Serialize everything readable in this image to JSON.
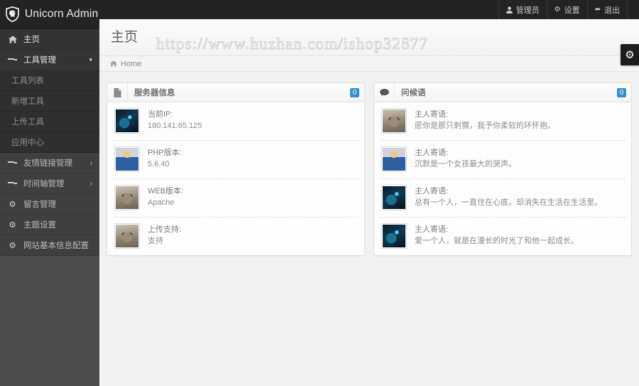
{
  "brand": {
    "name": "Unicorn Admin",
    "logo_icon": "shield-unicorn-icon"
  },
  "topbar": {
    "links": [
      {
        "label": "管理员",
        "icon": "user-icon"
      },
      {
        "label": "设置",
        "icon": "gear-icon"
      },
      {
        "label": "退出",
        "icon": "signout-icon"
      }
    ],
    "gear_tab_icon": "gear-icon"
  },
  "page": {
    "title": "主页",
    "watermark": "https://www.huzhan.com/ishop32877",
    "breadcrumb": {
      "icon": "home-icon",
      "label": "Home"
    }
  },
  "sidebar": {
    "items": [
      {
        "label": "主页",
        "icon": "home-icon",
        "state": "active",
        "caret": ""
      },
      {
        "label": "工具管理",
        "icon": "list-icon",
        "state": "open",
        "caret": "▾"
      },
      {
        "label": "友情链接管理",
        "icon": "list-icon",
        "state": "",
        "caret": "›"
      },
      {
        "label": "时间轴管理",
        "icon": "list-icon",
        "state": "",
        "caret": "›"
      },
      {
        "label": "留言管理",
        "icon": "gear-icon",
        "state": "",
        "caret": ""
      },
      {
        "label": "主题设置",
        "icon": "gear-icon",
        "state": "",
        "caret": ""
      },
      {
        "label": "网站基本信息配置",
        "icon": "gear-icon",
        "state": "",
        "caret": ""
      }
    ],
    "submenu": [
      {
        "label": "工具列表"
      },
      {
        "label": "新增工具"
      },
      {
        "label": "上传工具"
      },
      {
        "label": "应用中心"
      }
    ]
  },
  "panels": {
    "server": {
      "title": "服务器信息",
      "icon": "file-icon",
      "badge": "0",
      "rows": [
        {
          "label": "当前IP:",
          "value": "180.141.65.125",
          "avatar": "av-blue"
        },
        {
          "label": "PHP版本:",
          "value": "5.6.40",
          "avatar": "av-cop"
        },
        {
          "label": "WEB版本:",
          "value": "Apache",
          "avatar": "av-raccoon"
        },
        {
          "label": "上传支持:",
          "value": "支持",
          "avatar": "av-raccoon"
        }
      ]
    },
    "greeting": {
      "title": "问候语",
      "icon": "comment-icon",
      "badge": "0",
      "rows": [
        {
          "label": "主人寄语:",
          "value": "愿你是那只刺猬，我予你柔软的环怀抱。",
          "avatar": "av-raccoon"
        },
        {
          "label": "主人寄语:",
          "value": "沉默是一个女孩最大的哭声。",
          "avatar": "av-cop"
        },
        {
          "label": "主人寄语:",
          "value": "总有一个人，一直住在心底，却消失在生活在生活里。",
          "avatar": "av-blue"
        },
        {
          "label": "主人寄语:",
          "value": "爱一个人，就是在漫长的时光了和他一起成长。",
          "avatar": "av-blue"
        }
      ]
    }
  },
  "colors": {
    "accent": "#2f90d6",
    "sidebar_dark": "#232323",
    "sidebar": "#3f3f3f"
  }
}
